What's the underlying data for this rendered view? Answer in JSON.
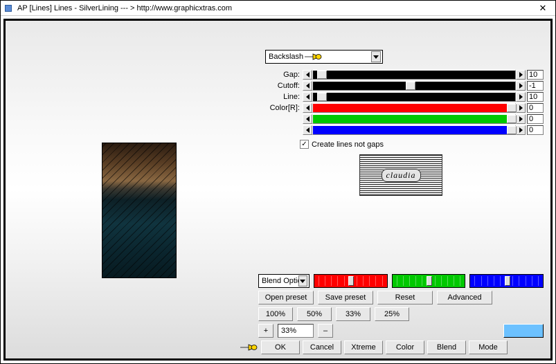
{
  "title": "AP [Lines]  Lines - SilverLining    --- >  http://www.graphicxtras.com",
  "dropdown": {
    "selected": "Backslash"
  },
  "sliders": {
    "gap": {
      "label": "Gap:",
      "value": "10",
      "fill": "#000000",
      "thumb_pct": 2
    },
    "cutoff": {
      "label": "Cutoff:",
      "value": "-1",
      "fill": "#000000",
      "thumb_pct": 46
    },
    "line": {
      "label": "Line:",
      "value": "10",
      "fill": "#000000",
      "thumb_pct": 2
    },
    "r": {
      "label": "Color[R]:",
      "value": "0",
      "fill": "#ff0000",
      "thumb_pct": 96
    },
    "g": {
      "label": "",
      "value": "0",
      "fill": "#00c800",
      "thumb_pct": 96
    },
    "b": {
      "label": "",
      "value": "0",
      "fill": "#0000ff",
      "thumb_pct": 96
    }
  },
  "checkbox": {
    "create_lines_not_gaps": "Create lines not gaps"
  },
  "logo_text": "claudia",
  "blend_dropdown": "Blend Optic",
  "rgb_blend": {
    "r": {
      "fill": "#ff0000",
      "thumb_pct": 47
    },
    "g": {
      "fill": "#00c800",
      "thumb_pct": 47
    },
    "b": {
      "fill": "#0000ff",
      "thumb_pct": 47
    }
  },
  "buttons": {
    "open_preset": "Open preset",
    "save_preset": "Save preset",
    "reset": "Reset",
    "advanced": "Advanced",
    "z100": "100%",
    "z50": "50%",
    "z33": "33%",
    "z25": "25%",
    "zoom_value": "33%",
    "plus": "+",
    "minus": "–",
    "ok": "OK",
    "cancel": "Cancel",
    "xtreme": "Xtreme",
    "color": "Color",
    "blend": "Blend",
    "mode": "Mode"
  },
  "swatch_color": "#7cc3ff"
}
